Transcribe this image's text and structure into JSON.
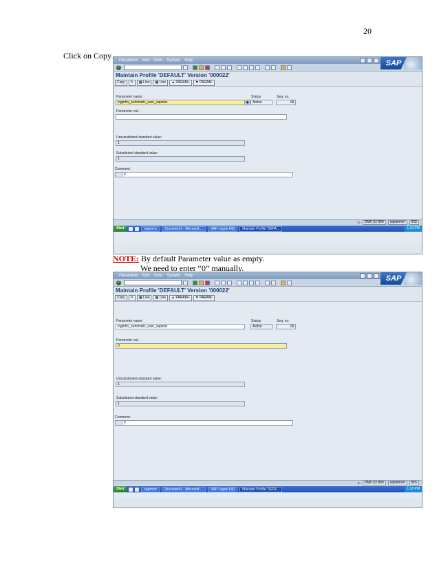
{
  "page_number": "20",
  "instruction": "Click on Copy.",
  "note": {
    "label": "NOTE:",
    "line1": " By default Parameter value as empty.",
    "line2": "We need to enter “0” manually."
  },
  "sap": {
    "menu": [
      "Parameter",
      "Edit",
      "Goto",
      "System",
      "Help"
    ],
    "logo": "SAP",
    "check_icon": "check-icon",
    "screen_title": "Maintain Profile 'DEFAULT' Version '000022'",
    "app_buttons": {
      "copy": "Copy",
      "line1": "Line",
      "line2": "Line",
      "param_prev": "PARAM+",
      "param_next": "PARAM-"
    },
    "labels": {
      "param_name": "Parameter name:",
      "status": "Status",
      "seq": "Seq. no.",
      "param_val": "Parameter val.:",
      "unsub": "Unsubstituted standard value:",
      "sub": "Substituted standard value:",
      "comment": "Comment:"
    },
    "status_bar": {
      "system": "DM0 (1) 800",
      "server": "sapserver",
      "mode": "INS"
    },
    "taskbar": {
      "start": "Start",
      "items": [
        "sapmmc",
        "Document1 - Microsoft ...",
        "SAP Logon 640",
        "Maintain Profile 'DEFA..."
      ]
    }
  },
  "screenshot_1": {
    "param_name_value": "loginho_automatic_user_sapstar",
    "status_value": "Active",
    "seq_value": "18",
    "param_val_value": "",
    "unsub_value": "1",
    "sub_value": "1",
    "comment_value": "#",
    "clock": "1:12 PM"
  },
  "screenshot_2": {
    "param_name_value": "loginho_automatic_user_sapstar",
    "status_value": "Active",
    "seq_value": "18",
    "param_val_value": "0",
    "unsub_value": "1",
    "sub_value": "1",
    "comment_value": "#",
    "clock": "1:16 PM"
  },
  "colors": {
    "sap_title": "#1e3a75",
    "highlight_field": "#f7ef9a",
    "note_red": "#cc0000"
  }
}
